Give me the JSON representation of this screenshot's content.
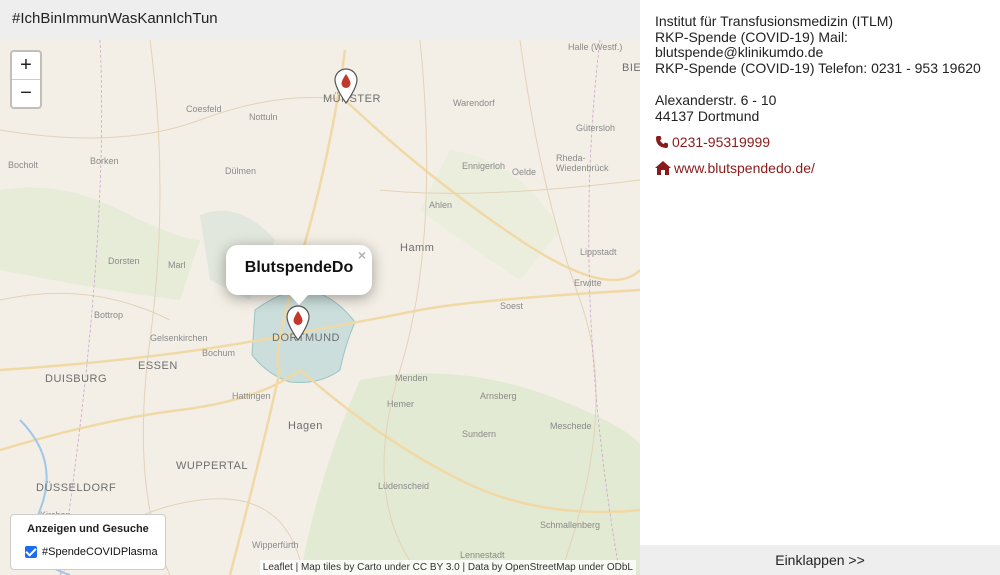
{
  "header": {
    "title": "#IchBinImmunWasKannIchTun"
  },
  "map": {
    "zoom_in_label": "+",
    "zoom_out_label": "−",
    "places": [
      "Halle (Westf.)",
      "BIE",
      "MÜNSTER",
      "Coesfeld",
      "Nottuln",
      "Warendorf",
      "Gütersloh",
      "Bocholt",
      "Borken",
      "Dülmen",
      "Ennigerloh",
      "Oelde",
      "Rheda-Wiedenbrück",
      "Ahlen",
      "Hamm",
      "Lippstadt",
      "Dorsten",
      "Marl",
      "Erwitte",
      "Soest",
      "Gelsenkirchen",
      "Bochum",
      "DORTMUND",
      "ESSEN",
      "DUISBURG",
      "Menden",
      "Arnsberg",
      "Hemer",
      "Hagen",
      "Sundern",
      "Meschede",
      "WUPPERTAL",
      "DÜSSELDORF",
      "Lüdenscheid",
      "Schmallenberg",
      "Wipperfürth",
      "Lennestadt",
      "Kirchen",
      "Bottrop",
      "Hattingen"
    ],
    "popup_title": "BlutspendeDo",
    "popup_close": "×",
    "legend_title": "Anzeigen und Gesuche",
    "legend_item": "#SpendeCOVIDPlasma",
    "legend_checked": true,
    "attribution": "Leaflet | Map tiles by Carto under CC BY 3.0 | Data by OpenStreetMap under ODbL",
    "marker_color": "#c0392b"
  },
  "sidebar": {
    "info_line1": "Institut für Transfusionsmedizin (ITLM)",
    "info_line2": "RKP-Spende (COVID-19) Mail:",
    "info_line3": "blutspende@klinikumdo.de",
    "info_line4": "RKP-Spende (COVID-19) Telefon: 0231 - 953 19620",
    "street": "Alexanderstr. 6 - 10",
    "city": "44137 Dortmund",
    "phone": "0231-95319999",
    "website": "www.blutspendedo.de/",
    "collapse_label": "Einklappen >>",
    "link_color": "#8b1a1a"
  }
}
